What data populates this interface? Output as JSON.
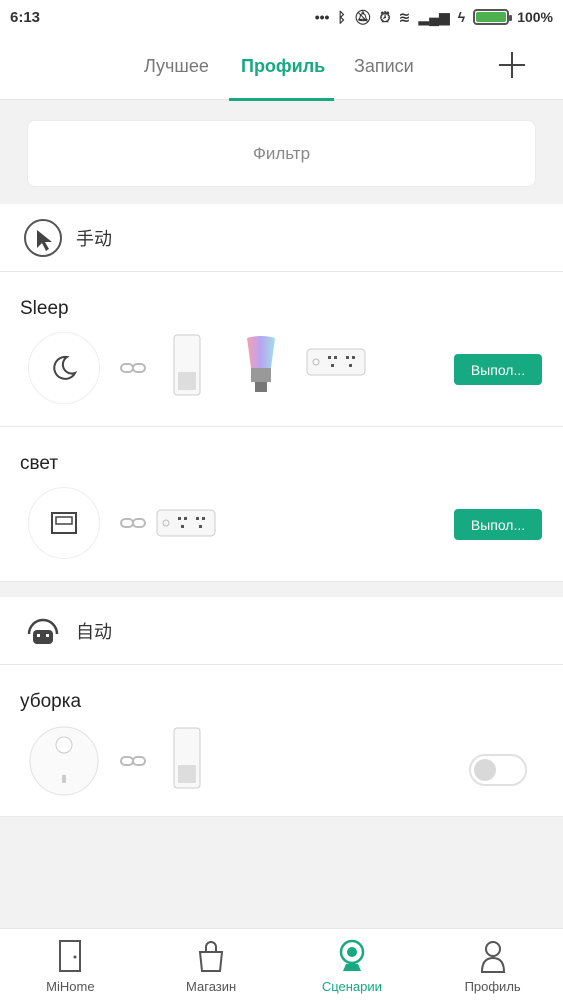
{
  "status_bar": {
    "time": "6:13",
    "battery": "100%",
    "battery_level": 1.0
  },
  "tabs": [
    {
      "label": "Лучшее"
    },
    {
      "label": "Профиль"
    },
    {
      "label": "Записи"
    }
  ],
  "filter": {
    "label": "Фильтр"
  },
  "manual_section": {
    "label": "手动",
    "scenes": [
      {
        "name": "Sleep",
        "run_label": "Выпол..."
      },
      {
        "name": "свет",
        "run_label": "Выпол..."
      }
    ]
  },
  "auto_section": {
    "label": "自动",
    "scenes": [
      {
        "name": "уборка",
        "enabled": false
      }
    ]
  },
  "bottom_nav": [
    {
      "label": "MiHome"
    },
    {
      "label": "Магазин"
    },
    {
      "label": "Сценарии"
    },
    {
      "label": "Профиль"
    }
  ],
  "colors": {
    "accent": "#16a982"
  }
}
